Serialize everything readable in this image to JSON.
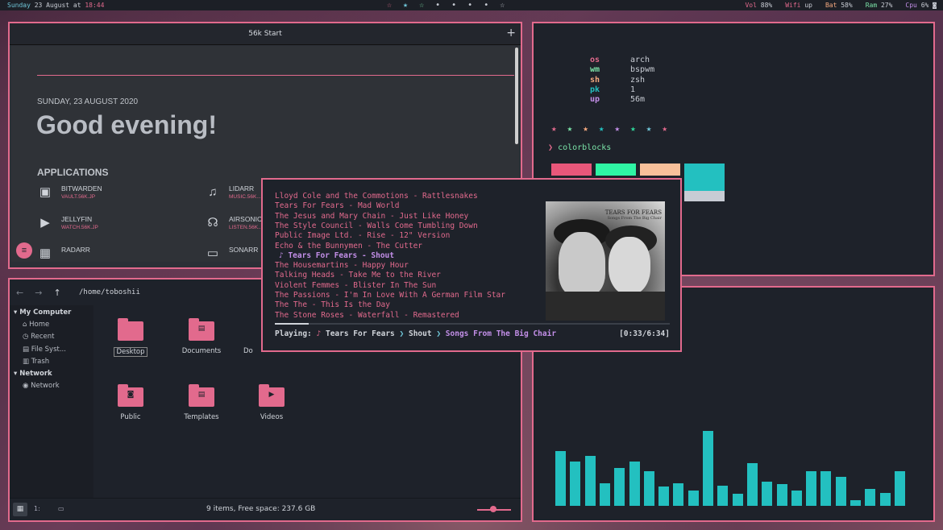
{
  "topbar": {
    "day": "Sunday",
    "date": "23 August at",
    "time": "18:44",
    "stars": [
      {
        "glyph": "☆",
        "color": "#e26a8d"
      },
      {
        "glyph": "★",
        "color": "#6fc6d8"
      },
      {
        "glyph": "☆",
        "color": "#7be3a8"
      },
      {
        "glyph": "•",
        "color": "#c8ccd4"
      },
      {
        "glyph": "•",
        "color": "#c8ccd4"
      },
      {
        "glyph": "•",
        "color": "#c8ccd4"
      },
      {
        "glyph": "•",
        "color": "#c8ccd4"
      },
      {
        "glyph": "☆",
        "color": "#c8ccd4"
      }
    ],
    "vol_label": "Vol",
    "vol": "88%",
    "wifi_label": "Wifi",
    "wifi": "up",
    "bat_label": "Bat",
    "bat": "58%",
    "ram_label": "Ram",
    "ram": "27%",
    "cpu_label": "Cpu",
    "cpu": "6%"
  },
  "browser": {
    "tab_title": "56k Start",
    "new_tab": "+",
    "date": "SUNDAY, 23 AUGUST 2020",
    "greeting": "Good evening!",
    "apps_heading": "APPLICATIONS",
    "apps": [
      {
        "name": "BITWARDEN",
        "url": "VAULT.56K.JP",
        "icon": "shield-icon",
        "glyph": "▣"
      },
      {
        "name": "LIDARR",
        "url": "MUSIC.56K...",
        "icon": "music-note-icon",
        "glyph": "♫"
      },
      {
        "name": "JELLYFIN",
        "url": "WATCH.56K.JP",
        "icon": "play-icon",
        "glyph": "▶"
      },
      {
        "name": "AIRSONIC",
        "url": "LISTEN.56K...",
        "icon": "headphones-icon",
        "glyph": "☊"
      },
      {
        "name": "RADARR",
        "url": "",
        "icon": "film-icon",
        "glyph": "▦"
      },
      {
        "name": "SONARR",
        "url": "",
        "icon": "tv-icon",
        "glyph": "▭"
      }
    ],
    "fab": "≡"
  },
  "fetch": {
    "info": [
      {
        "key": "os",
        "value": "arch",
        "color": "#e26a8d"
      },
      {
        "key": "wm",
        "value": "bspwm",
        "color": "#7be3a8"
      },
      {
        "key": "sh",
        "value": "zsh",
        "color": "#f5a97f"
      },
      {
        "key": "pk",
        "value": "1",
        "color": "#23c0c0"
      },
      {
        "key": "up",
        "value": "56m",
        "color": "#c38fe8"
      }
    ],
    "stars": [
      {
        "glyph": "★",
        "color": "#e26a8d"
      },
      {
        "glyph": "★",
        "color": "#7be3a8"
      },
      {
        "glyph": "★",
        "color": "#f5a97f"
      },
      {
        "glyph": "★",
        "color": "#23c0c0"
      },
      {
        "glyph": "★",
        "color": "#c38fe8"
      },
      {
        "glyph": "★",
        "color": "#2ed69a"
      },
      {
        "glyph": "★",
        "color": "#6fc6d8"
      },
      {
        "glyph": "★",
        "color": "#e26a8d"
      }
    ],
    "prompt_arrow": "❯",
    "command": "colorblocks",
    "blocks": [
      "#e8577a",
      "#2ff5a4",
      "#f8c09a",
      "#23c0c0"
    ]
  },
  "music": {
    "tracks": [
      "Lloyd Cole and the Commotions - Rattlesnakes",
      "Tears For Fears - Mad World",
      "The Jesus and Mary Chain - Just Like Honey",
      "The Style Council - Walls Come Tumbling Down",
      "Public Image Ltd. - Rise - 12\" Version",
      "Echo & the Bunnymen - The Cutter",
      "♪ Tears For Fears - Shout",
      "The Housemartins - Happy Hour",
      "Talking Heads - Take Me to the River",
      "Violent Femmes - Blister In The Sun",
      "The Passions - I'm In Love With A German Film Star",
      "The The - This Is the Day",
      "The Stone Roses - Waterfall - Remastered"
    ],
    "current_index": 6,
    "art_title": "TEARS FOR FEARS",
    "art_subtitle": "Songs From The Big Chair",
    "progress": 0.085,
    "playing_label": "Playing:",
    "note": "♪",
    "artist": "Tears For Fears",
    "sep": "❯",
    "song": "Shout",
    "album": "Songs From The Big Chair",
    "time": "[0:33/6:34]"
  },
  "files": {
    "back": "←",
    "forward": "→",
    "up": "↑",
    "path": "/home/toboshii",
    "sidebar": {
      "computer_heading": "▾ My Computer",
      "items": [
        {
          "icon": "home-icon",
          "glyph": "⌂",
          "label": "Home"
        },
        {
          "icon": "clock-icon",
          "glyph": "◷",
          "label": "Recent"
        },
        {
          "icon": "disk-icon",
          "glyph": "▤",
          "label": "File Syst..."
        },
        {
          "icon": "trash-icon",
          "glyph": "▥",
          "label": "Trash"
        }
      ],
      "network_heading": "▾ Network",
      "network_items": [
        {
          "icon": "network-icon",
          "glyph": "◉",
          "label": "Network"
        }
      ]
    },
    "folders": [
      {
        "name": "Desktop",
        "glyph": ""
      },
      {
        "name": "Documents",
        "glyph": "▤"
      },
      {
        "name": "Do",
        "glyph": ""
      },
      {
        "name": "Public",
        "glyph": "◙"
      },
      {
        "name": "Templates",
        "glyph": "▤"
      },
      {
        "name": "Videos",
        "glyph": "▶"
      }
    ],
    "status": "9 items, Free space: 237.6 GB",
    "view_icons": "▦",
    "view_compact": "1:",
    "view_list": "▭"
  },
  "visualizer": {
    "levels": [
      0.46,
      0.37,
      0.42,
      0.19,
      0.32,
      0.37,
      0.29,
      0.16,
      0.19,
      0.13,
      0.63,
      0.17,
      0.1,
      0.36,
      0.2,
      0.18,
      0.13,
      0.29,
      0.29,
      0.24,
      0.05,
      0.14,
      0.11,
      0.29
    ]
  }
}
